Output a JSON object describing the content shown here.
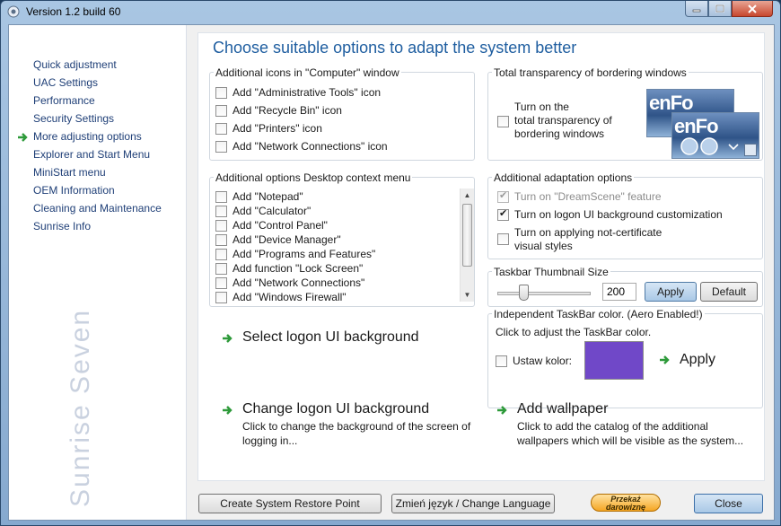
{
  "window": {
    "title": "Version 1.2 build 60"
  },
  "sidebar": {
    "items": [
      {
        "label": "Quick adjustment"
      },
      {
        "label": "UAC Settings"
      },
      {
        "label": "Performance"
      },
      {
        "label": "Security Settings"
      },
      {
        "label": "More adjusting options",
        "active": true
      },
      {
        "label": "Explorer and Start Menu"
      },
      {
        "label": "MiniStart menu"
      },
      {
        "label": "OEM Information"
      },
      {
        "label": "Cleaning and Maintenance"
      },
      {
        "label": "Sunrise Info"
      }
    ],
    "brand": "Sunrise Seven"
  },
  "main": {
    "title": "Choose suitable options to adapt the system better",
    "computer_icons": {
      "title": "Additional icons in \"Computer\" window",
      "items": [
        {
          "label": "Add \"Administrative Tools\" icon",
          "checked": false
        },
        {
          "label": "Add \"Recycle Bin\" icon",
          "checked": false
        },
        {
          "label": "Add \"Printers\" icon",
          "checked": false
        },
        {
          "label": "Add \"Network Connections\" icon",
          "checked": false
        }
      ]
    },
    "transparency": {
      "title": "Total transparency of bordering windows",
      "label": "Turn on the total transparency of bordering windows",
      "label_lines": [
        "Turn on the",
        "total transparency of",
        "bordering windows"
      ],
      "checked": false,
      "preview_text": "enFo"
    },
    "desktop_menu": {
      "title": "Additional options Desktop context menu",
      "items": [
        {
          "label": "Add \"Notepad\"",
          "checked": false
        },
        {
          "label": "Add \"Calculator\"",
          "checked": false
        },
        {
          "label": "Add \"Control Panel\"",
          "checked": false
        },
        {
          "label": "Add \"Device Manager\"",
          "checked": false
        },
        {
          "label": "Add \"Programs and Features\"",
          "checked": false
        },
        {
          "label": "Add function \"Lock Screen\"",
          "checked": false
        },
        {
          "label": "Add \"Network Connections\"",
          "checked": false
        },
        {
          "label": "Add \"Windows Firewall\"",
          "checked": false
        }
      ]
    },
    "adaptation": {
      "title": "Additional adaptation options",
      "items": [
        {
          "label": "Turn on \"DreamScene\" feature",
          "checked": true,
          "disabled": true
        },
        {
          "label": "Turn on logon UI background customization",
          "checked": true,
          "disabled": false
        },
        {
          "label_lines": [
            "Turn on applying not-certificate",
            "visual styles"
          ],
          "checked": false,
          "disabled": false
        }
      ]
    },
    "thumbnail": {
      "title": "Taskbar Thumbnail Size",
      "value": "200",
      "slider_level": 0.28,
      "apply_label": "Apply",
      "default_label": "Default"
    },
    "taskbar_color": {
      "title": "Independent TaskBar color. (Aero Enabled!)",
      "hint": "Click to adjust the TaskBar color.",
      "checkbox_label": "Ustaw kolor:",
      "checked": false,
      "color": "#7048c8",
      "apply_label": "Apply"
    },
    "links": {
      "select_logon": {
        "label": "Select logon UI background"
      },
      "change_logon": {
        "label": "Change logon UI background",
        "desc_lines": [
          "Click to change the background of the screen of",
          "logging in..."
        ]
      },
      "add_wallpaper": {
        "label": "Add wallpaper",
        "desc_lines": [
          "Click to add the catalog of the additional",
          "wallpapers which will be visible as the system..."
        ]
      }
    }
  },
  "footer": {
    "restore_label": "Create System Restore Point",
    "language_label": "Zmień język / Change Language",
    "donate_lines": [
      "Przekaż",
      "darowiznę"
    ],
    "close_label": "Close"
  },
  "colors": {
    "accent_title": "#1f5ea0",
    "link_arrow": "#2e9a3a",
    "nav_text": "#1f3f77"
  }
}
